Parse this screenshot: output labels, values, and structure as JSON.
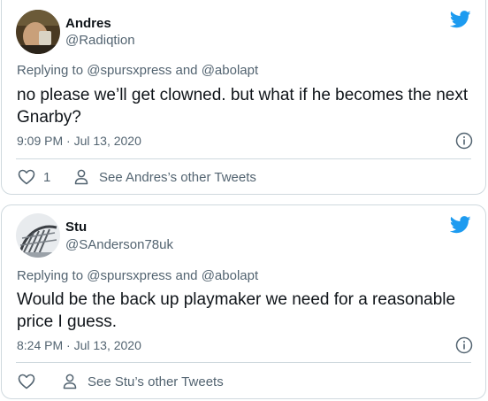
{
  "tweets": [
    {
      "author_name": "Andres",
      "author_handle": "@Radiqtion",
      "replying_prefix": "Replying to ",
      "reply_to_1": "@spursxpress",
      "reply_conjunction": " and ",
      "reply_to_2": "@abolapt",
      "text": "no please we’ll get clowned. but what if he becomes the next Gnarby?",
      "timestamp": "9:09 PM · Jul 13, 2020",
      "like_count": "1",
      "other_tweets_label": "See Andres’s other Tweets"
    },
    {
      "author_name": "Stu",
      "author_handle": "@SAnderson78uk",
      "replying_prefix": "Replying to ",
      "reply_to_1": "@spursxpress",
      "reply_conjunction": " and ",
      "reply_to_2": "@abolapt",
      "text": "Would be the back up playmaker we need for a reasonable price I guess.",
      "timestamp": "8:24 PM · Jul 13, 2020",
      "like_count": "",
      "other_tweets_label": "See Stu’s other Tweets"
    }
  ],
  "icons": {
    "brand": "twitter-bird-icon",
    "info": "info-icon",
    "like": "heart-icon",
    "profile": "person-icon"
  },
  "colors": {
    "brand_blue": "#1d9bf0",
    "text_primary": "#0f1419",
    "text_secondary": "#536471",
    "border": "#cfd9de"
  }
}
